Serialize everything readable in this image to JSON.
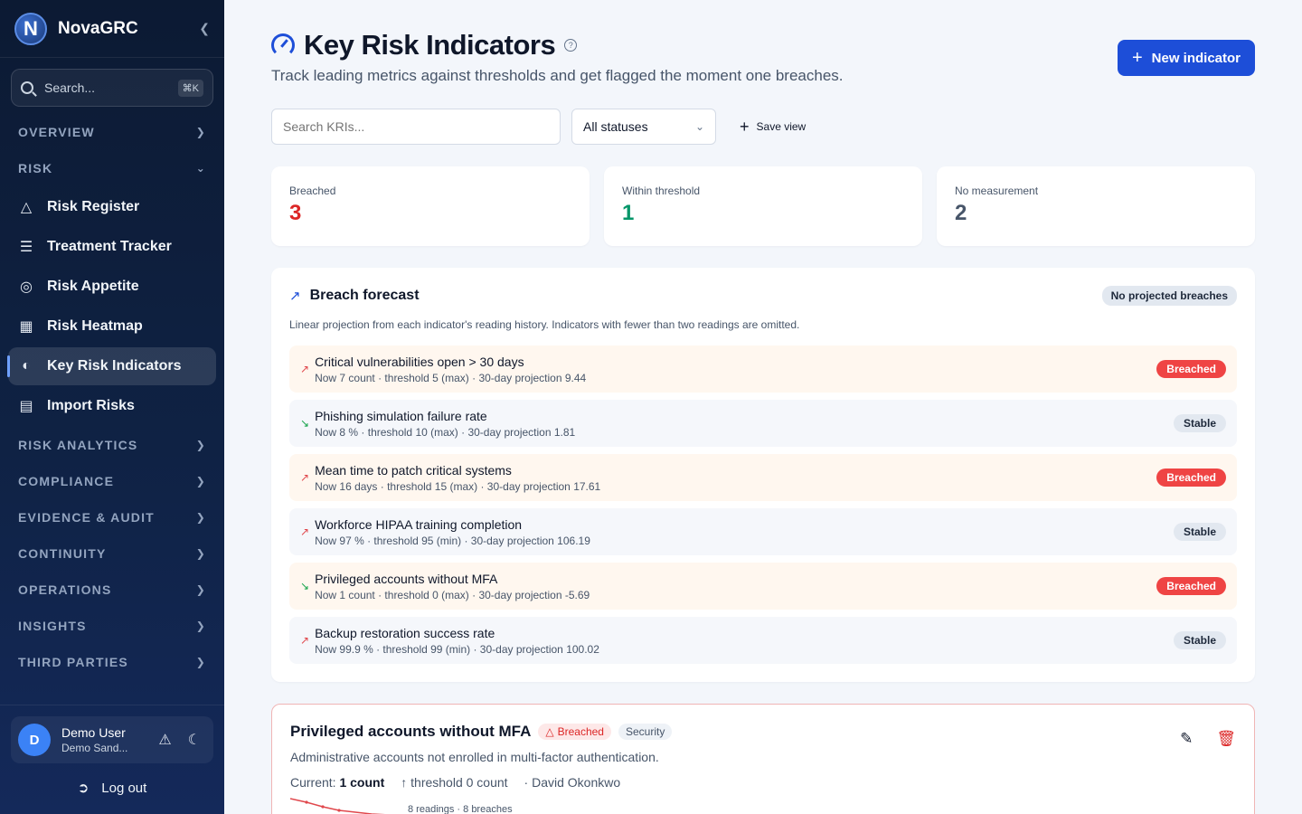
{
  "brand": {
    "logo_letter": "N",
    "name": "NovaGRC"
  },
  "sidebar": {
    "search_placeholder": "Search...",
    "search_shortcut": "⌘K",
    "sections": {
      "overview": "OVERVIEW",
      "risk": "RISK",
      "risk_analytics": "RISK ANALYTICS",
      "compliance": "COMPLIANCE",
      "evidence_audit": "EVIDENCE & AUDIT",
      "continuity": "CONTINUITY",
      "operations": "OPERATIONS",
      "insights": "INSIGHTS",
      "third_parties": "THIRD PARTIES"
    },
    "risk_items": [
      {
        "label": "Risk Register",
        "icon": "warning-triangle-icon"
      },
      {
        "label": "Treatment Tracker",
        "icon": "checklist-icon"
      },
      {
        "label": "Risk Appetite",
        "icon": "target-icon"
      },
      {
        "label": "Risk Heatmap",
        "icon": "grid-icon"
      },
      {
        "label": "Key Risk Indicators",
        "icon": "gauge-icon",
        "active": true
      },
      {
        "label": "Import Risks",
        "icon": "file-sheet-icon"
      }
    ],
    "user": {
      "initial": "D",
      "name": "Demo User",
      "org": "Demo Sand..."
    },
    "logout_label": "Log out"
  },
  "header": {
    "title": "Key Risk Indicators",
    "subtitle": "Track leading metrics against thresholds and get flagged the moment one breaches.",
    "new_button": "New indicator"
  },
  "filters": {
    "search_placeholder": "Search KRIs...",
    "status_selected": "All statuses",
    "save_view": "Save view"
  },
  "stats": [
    {
      "label": "Breached",
      "value": "3",
      "color": "#dc2626"
    },
    {
      "label": "Within threshold",
      "value": "1",
      "color": "#059669"
    },
    {
      "label": "No measurement",
      "value": "2",
      "color": "#475569"
    }
  ],
  "forecast": {
    "title": "Breach forecast",
    "badge": "No projected breaches",
    "description": "Linear projection from each indicator's reading history. Indicators with fewer than two readings are omitted.",
    "rows": [
      {
        "name": "Critical vulnerabilities open > 30 days",
        "detail": "Now 7 count · threshold 5 (max) · 30-day projection 9.44",
        "status": "Breached",
        "trend": "up"
      },
      {
        "name": "Phishing simulation failure rate",
        "detail": "Now 8 % · threshold 10 (max) · 30-day projection 1.81",
        "status": "Stable",
        "trend": "down"
      },
      {
        "name": "Mean time to patch critical systems",
        "detail": "Now 16 days · threshold 15 (max) · 30-day projection 17.61",
        "status": "Breached",
        "trend": "up"
      },
      {
        "name": "Workforce HIPAA training completion",
        "detail": "Now 97 % · threshold 95 (min) · 30-day projection 106.19",
        "status": "Stable",
        "trend": "up"
      },
      {
        "name": "Privileged accounts without MFA",
        "detail": "Now 1 count · threshold 0 (max) · 30-day projection -5.69",
        "status": "Breached",
        "trend": "down"
      },
      {
        "name": "Backup restoration success rate",
        "detail": "Now 99.9 % · threshold 99 (min) · 30-day projection 100.02",
        "status": "Stable",
        "trend": "up"
      }
    ]
  },
  "kri_card": {
    "name": "Privileged accounts without MFA",
    "status_badge": "Breached",
    "category": "Security",
    "description": "Administrative accounts not enrolled in multi-factor authentication.",
    "current_label": "Current:",
    "current_value": "1 count",
    "threshold": "threshold 0 count",
    "owner": "· David Okonkwo",
    "readings_caption": "8 readings · 8 breaches"
  }
}
